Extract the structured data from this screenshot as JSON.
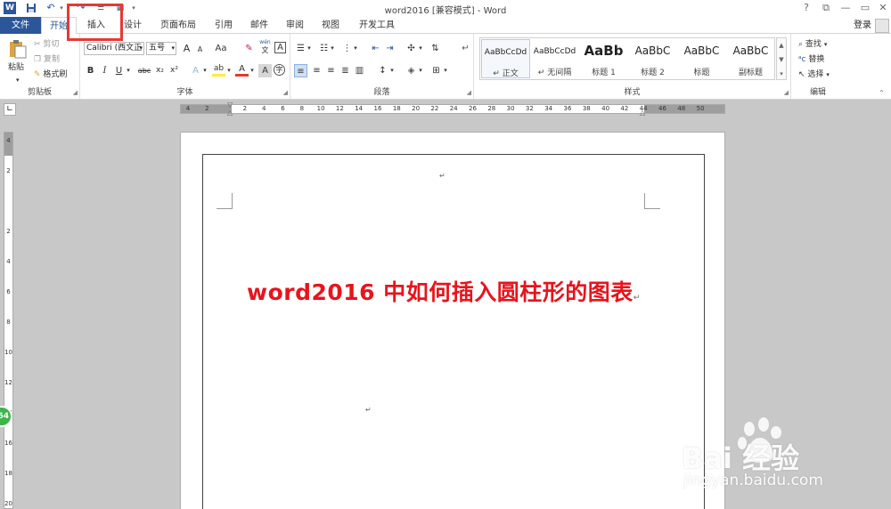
{
  "window": {
    "title": "word2016 [兼容模式] - Word"
  },
  "quick_access": {
    "word_icon": "W",
    "save_icon": "save-icon",
    "undo": "↶",
    "redo": "↷",
    "more": "▾"
  },
  "window_controls": {
    "help": "?",
    "restore": "⧉",
    "minimize": "—",
    "maximize": "▭",
    "close": "✕"
  },
  "tabs": [
    {
      "label": "文件"
    },
    {
      "label": "开始"
    },
    {
      "label": "插入"
    },
    {
      "label": "设计"
    },
    {
      "label": "页面布局"
    },
    {
      "label": "引用"
    },
    {
      "label": "邮件"
    },
    {
      "label": "审阅"
    },
    {
      "label": "视图"
    },
    {
      "label": "开发工具"
    }
  ],
  "login": "登录",
  "clipboard": {
    "paste": "粘贴",
    "cut": "剪切",
    "copy": "复制",
    "format_painter": "格式刷",
    "label": "剪贴板"
  },
  "font": {
    "name": "Calibri (西文正",
    "size": "五号",
    "label": "字体",
    "grow": "A",
    "shrink": "A",
    "case": "Aa",
    "clear": "✎",
    "phonetic_top": "wén",
    "phonetic_bottom": "文",
    "border": "A",
    "bold": "B",
    "italic": "I",
    "underline": "U",
    "strike": "abc",
    "sub": "x₂",
    "sup": "x²",
    "effects": "A",
    "highlight": "ab",
    "color": "A",
    "shade": "A",
    "enclose": "字"
  },
  "paragraph": {
    "label": "段落"
  },
  "styles": {
    "label": "样式",
    "items": [
      {
        "preview": "AaBbCcDd",
        "name": "↵ 正文"
      },
      {
        "preview": "AaBbCcDd",
        "name": "↵ 无间隔"
      },
      {
        "preview": "AaBb",
        "name": "标题 1"
      },
      {
        "preview": "AaBbC",
        "name": "标题 2"
      },
      {
        "preview": "AaBbC",
        "name": "标题"
      },
      {
        "preview": "AaBbC",
        "name": "副标题"
      }
    ]
  },
  "editing": {
    "find": "查找",
    "replace": "替换",
    "select": "选择",
    "label": "编辑"
  },
  "ruler": {
    "ticks": [
      "4",
      "2",
      "",
      "2",
      "4",
      "6",
      "8",
      "10",
      "12",
      "14",
      "16",
      "18",
      "20",
      "22",
      "24",
      "26",
      "28",
      "30",
      "32",
      "34",
      "36",
      "38",
      "40",
      "42",
      "44",
      "46",
      "48",
      "50"
    ]
  },
  "vruler": {
    "ticks": [
      "4",
      "2",
      "",
      "2",
      "4",
      "6",
      "8",
      "10",
      "12",
      "14",
      "16",
      "18",
      "20"
    ]
  },
  "document": {
    "title": "word2016 中如何插入圆柱形的图表"
  },
  "side_badge": "64",
  "watermark": {
    "brand": "Bai  经验",
    "url": "jingyan.baidu.com"
  },
  "colors": {
    "word_blue": "#2b579a",
    "title_red": "#e8141c",
    "highlight_box": "#e53935"
  }
}
